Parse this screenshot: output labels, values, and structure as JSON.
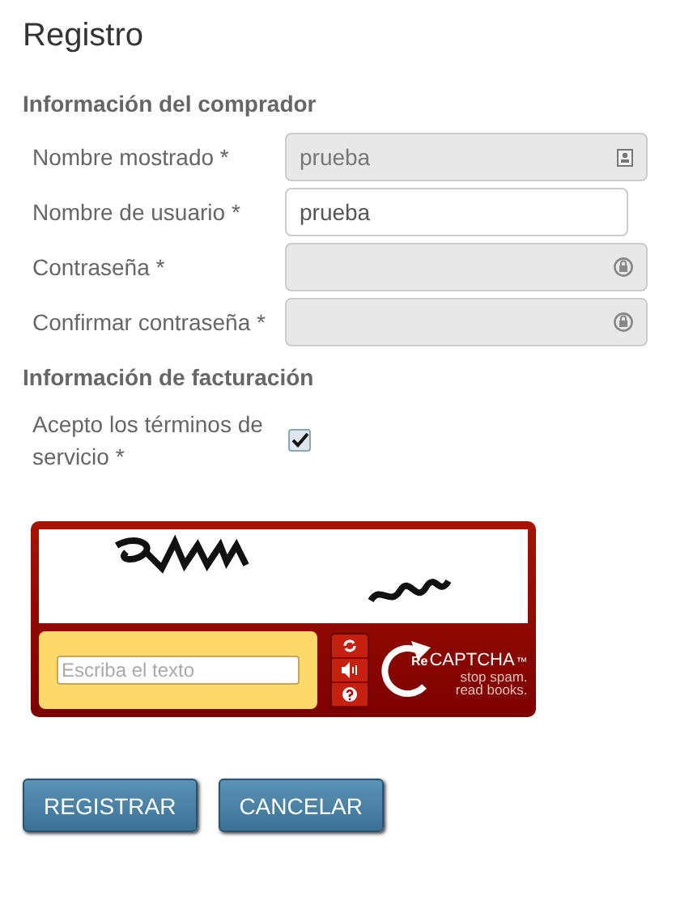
{
  "title": "Registro",
  "buyer_section": {
    "heading": "Información del comprador",
    "fields": [
      {
        "label": "Nombre mostrado *",
        "value": "prueba",
        "kind": "name",
        "disabled": true
      },
      {
        "label": "Nombre de usuario *",
        "value": "prueba",
        "kind": "text",
        "disabled": false
      },
      {
        "label": "Contraseña *",
        "kind": "password",
        "disabled": true
      },
      {
        "label": "Confirmar contraseña *",
        "kind": "password",
        "disabled": true
      }
    ]
  },
  "billing_section": {
    "heading": "Información de facturación",
    "terms": {
      "label": "Acepto los términos de servicio *",
      "checked": true
    }
  },
  "captcha": {
    "placeholder": "Escriba el texto",
    "logo_prefix": "Re",
    "logo_name": "CAPTCHA",
    "trademark": "™",
    "slogan_1": "stop spam.",
    "slogan_2": "read books."
  },
  "buttons": [
    "REGISTRAR",
    "CANCELAR"
  ]
}
